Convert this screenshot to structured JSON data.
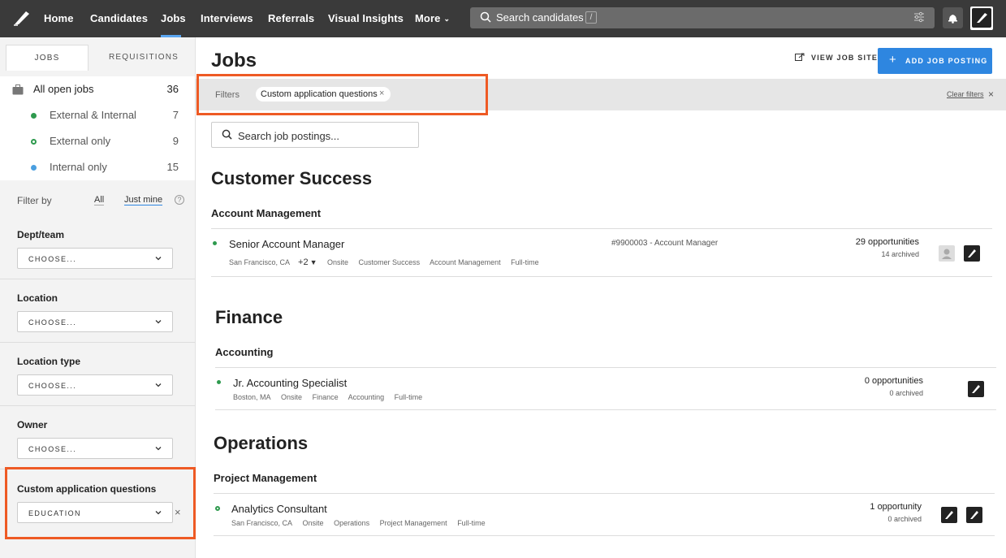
{
  "nav": {
    "items": [
      "Home",
      "Candidates",
      "Jobs",
      "Interviews",
      "Referrals",
      "Visual Insights"
    ],
    "more": "More",
    "search_placeholder": "Search candidates",
    "search_shortcut": "/"
  },
  "sidebar": {
    "tabs": [
      "JOBS",
      "REQUISITIONS"
    ],
    "job_groups": [
      {
        "label": "All open jobs",
        "count": "36"
      },
      {
        "label": "External & Internal",
        "count": "7"
      },
      {
        "label": "External only",
        "count": "9"
      },
      {
        "label": "Internal only",
        "count": "15"
      }
    ],
    "filter_by": {
      "label": "Filter by",
      "all": "All",
      "just_mine": "Just mine",
      "help": "?"
    },
    "filters": [
      {
        "title": "Dept/team",
        "value": "CHOOSE..."
      },
      {
        "title": "Location",
        "value": "CHOOSE..."
      },
      {
        "title": "Location type",
        "value": "CHOOSE..."
      },
      {
        "title": "Owner",
        "value": "CHOOSE..."
      },
      {
        "title": "Custom application questions",
        "value": "EDUCATION"
      }
    ]
  },
  "main": {
    "title": "Jobs",
    "view_job_site": "VIEW JOB SITE",
    "add_job_posting": "ADD JOB POSTING",
    "filter_bar": {
      "label": "Filters",
      "chip": "Custom application questions",
      "clear": "Clear filters"
    },
    "search_placeholder": "Search job postings...",
    "departments": [
      {
        "name": "Customer Success",
        "team": "Account Management",
        "posting": {
          "title": "Senior Account Manager",
          "location": "San Francisco, CA",
          "more_locations": "+2",
          "tags": [
            "Onsite",
            "Customer Success",
            "Account Management",
            "Full-time"
          ],
          "requisition": "#9900003 - Account Manager",
          "opportunities": "29 opportunities",
          "archived": "14 archived"
        }
      },
      {
        "name": "Finance",
        "team": "Accounting",
        "posting": {
          "title": "Jr. Accounting Specialist",
          "location": "Boston, MA",
          "tags": [
            "Onsite",
            "Finance",
            "Accounting",
            "Full-time"
          ],
          "opportunities": "0 opportunities",
          "archived": "0 archived"
        }
      },
      {
        "name": "Operations",
        "team": "Project Management",
        "posting": {
          "title": "Analytics Consultant",
          "location": "San Francisco, CA",
          "tags": [
            "Onsite",
            "Operations",
            "Project Management",
            "Full-time"
          ],
          "opportunities": "1 opportunity",
          "archived": "0 archived"
        }
      }
    ]
  },
  "colors": {
    "accent": "#2e86e0",
    "highlight": "#ee5a24",
    "status_green": "#2e9a4e",
    "status_blue": "#4a9fe0"
  }
}
